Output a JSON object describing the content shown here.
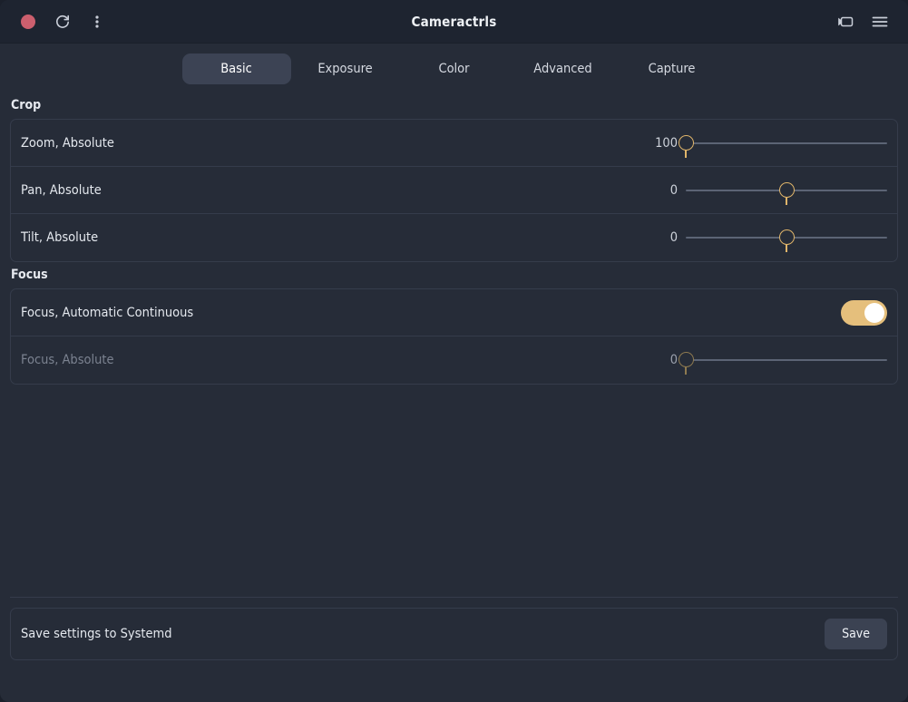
{
  "window": {
    "title": "Cameractrls",
    "background_color": "#262c38",
    "header_color": "#1e2430",
    "accent_color": "#e0b56a"
  },
  "header": {
    "record_indicator": {
      "name": "record-indicator",
      "color": "#cc5f6e"
    },
    "reload_button": {
      "icon": "reload-icon",
      "label": ""
    },
    "menu_button": {
      "icon": "three-dots-vertical-icon",
      "label": ""
    },
    "camera_button": {
      "icon": "camera-icon",
      "label": ""
    },
    "hamburger_button": {
      "icon": "hamburger-menu-icon",
      "label": ""
    }
  },
  "tabs": [
    {
      "id": "basic",
      "label": "Basic",
      "active": true
    },
    {
      "id": "exposure",
      "label": "Exposure",
      "active": false
    },
    {
      "id": "color",
      "label": "Color",
      "active": false
    },
    {
      "id": "advanced",
      "label": "Advanced",
      "active": false
    },
    {
      "id": "capture",
      "label": "Capture",
      "active": false
    }
  ],
  "sections": [
    {
      "id": "crop",
      "title": "Crop",
      "rows": [
        {
          "id": "zoom-absolute",
          "label": "Zoom, Absolute",
          "control": "slider",
          "value": "100",
          "percent": 0,
          "disabled": false
        },
        {
          "id": "pan-absolute",
          "label": "Pan, Absolute",
          "control": "slider",
          "value": "0",
          "percent": 50,
          "disabled": false
        },
        {
          "id": "tilt-absolute",
          "label": "Tilt, Absolute",
          "control": "slider",
          "value": "0",
          "percent": 50,
          "disabled": false
        }
      ]
    },
    {
      "id": "focus",
      "title": "Focus",
      "rows": [
        {
          "id": "focus-automatic-continuous",
          "label": "Focus, Automatic Continuous",
          "control": "toggle",
          "value": "on",
          "disabled": false
        },
        {
          "id": "focus-absolute",
          "label": "Focus, Absolute",
          "control": "slider",
          "value": "0",
          "percent": 0,
          "disabled": true
        }
      ]
    }
  ],
  "footer": {
    "label": "Save settings to Systemd",
    "save_button_label": "Save"
  }
}
